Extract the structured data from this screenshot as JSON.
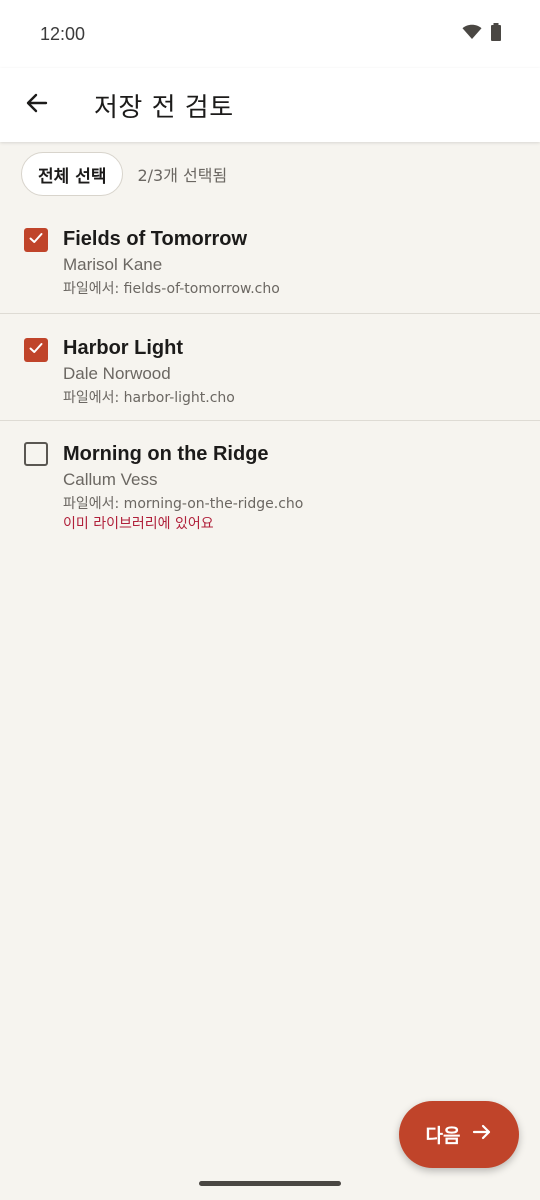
{
  "status_bar": {
    "time": "12:00",
    "icons": [
      "wifi-icon",
      "battery-icon"
    ]
  },
  "app_bar": {
    "title": "저장 전 검토",
    "back_icon": "arrow-back-icon"
  },
  "selection": {
    "select_all_label": "전체 선택",
    "count_text": "2/3개 선택됨"
  },
  "items": [
    {
      "title": "Fields of Tomorrow",
      "artist": "Marisol Kane",
      "source": "파일에서: fields-of-tomorrow.cho",
      "checked": true,
      "warning": ""
    },
    {
      "title": "Harbor Light",
      "artist": "Dale Norwood",
      "source": "파일에서: harbor-light.cho",
      "checked": true,
      "warning": ""
    },
    {
      "title": "Morning on the Ridge",
      "artist": "Callum Vess",
      "source": "파일에서: morning-on-the-ridge.cho",
      "checked": false,
      "warning": "이미 라이브러리에 있어요"
    }
  ],
  "fab": {
    "label": "다음",
    "icon": "arrow-forward-icon"
  },
  "colors": {
    "accent": "#c0442a",
    "warning": "#b0203a",
    "background": "#f6f4ef"
  }
}
